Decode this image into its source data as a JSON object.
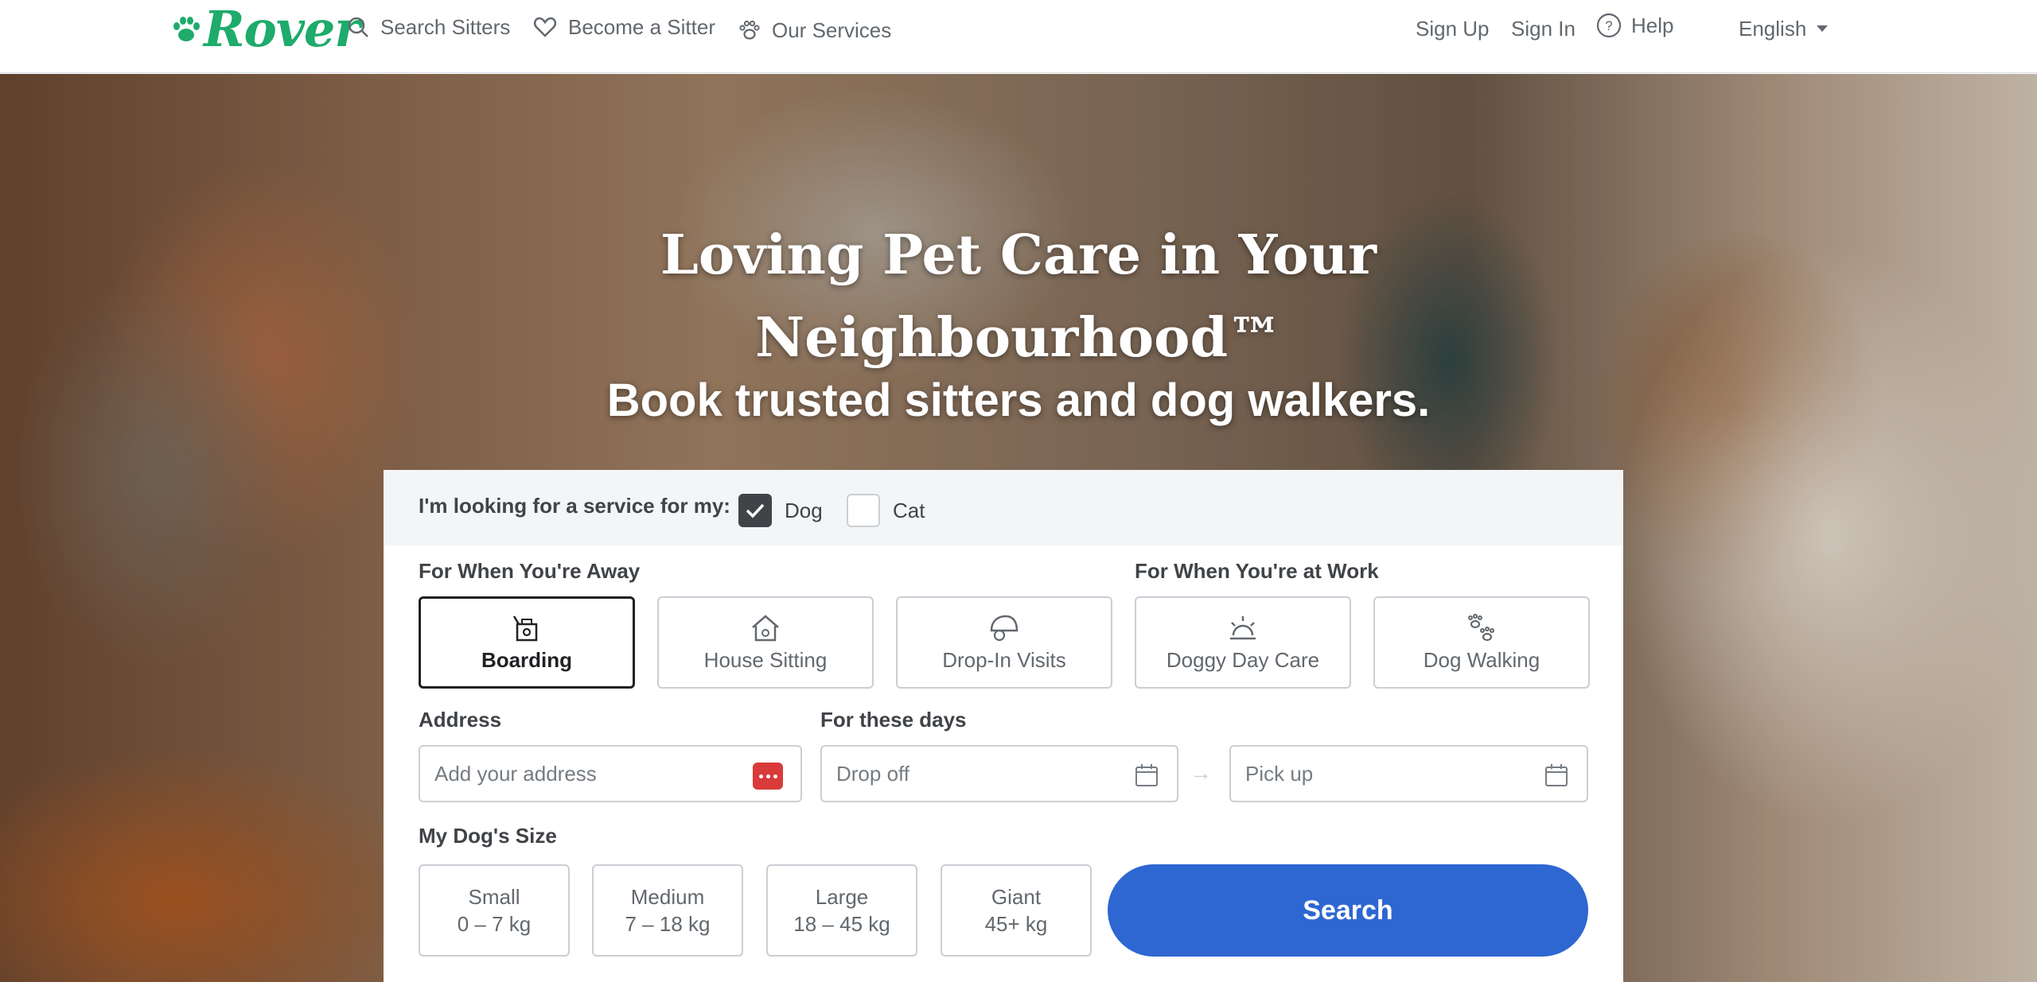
{
  "header": {
    "logo_text": "Rover",
    "nav": [
      {
        "label": "Search Sitters",
        "icon": "search-icon"
      },
      {
        "label": "Become a Sitter",
        "icon": "heart-icon"
      },
      {
        "label": "Our Services",
        "icon": "paw-icon"
      }
    ],
    "sign_up": "Sign Up",
    "sign_in": "Sign In",
    "help": "Help",
    "language": "English"
  },
  "hero": {
    "title_line1": "Loving Pet Care in Your",
    "title_line2": "Neighbourhood™",
    "subtitle": "Book trusted sitters and dog walkers."
  },
  "search": {
    "looking_label": "I'm looking for a service for my:",
    "pets": [
      {
        "label": "Dog",
        "checked": true
      },
      {
        "label": "Cat",
        "checked": false
      }
    ],
    "away_label": "For When You're Away",
    "work_label": "For When You're at Work",
    "services": [
      {
        "label": "Boarding",
        "icon": "boarding-icon",
        "selected": true
      },
      {
        "label": "House Sitting",
        "icon": "house-icon",
        "selected": false
      },
      {
        "label": "Drop-In Visits",
        "icon": "drop-in-icon",
        "selected": false
      },
      {
        "label": "Doggy Day Care",
        "icon": "sun-icon",
        "selected": false
      },
      {
        "label": "Dog Walking",
        "icon": "paw-prints-icon",
        "selected": false
      }
    ],
    "address_label": "Address",
    "address_placeholder": "Add your address",
    "days_label": "For these days",
    "drop_off_placeholder": "Drop off",
    "pick_up_placeholder": "Pick up",
    "size_label": "My Dog's Size",
    "sizes": [
      {
        "name": "Small",
        "range": "0 – 7 kg"
      },
      {
        "name": "Medium",
        "range": "7 – 18 kg"
      },
      {
        "name": "Large",
        "range": "18 – 45 kg"
      },
      {
        "name": "Giant",
        "range": "45+ kg"
      }
    ],
    "search_button": "Search"
  },
  "colors": {
    "brand": "#1eab6b",
    "button": "#2e67d1",
    "text": "#404347"
  }
}
